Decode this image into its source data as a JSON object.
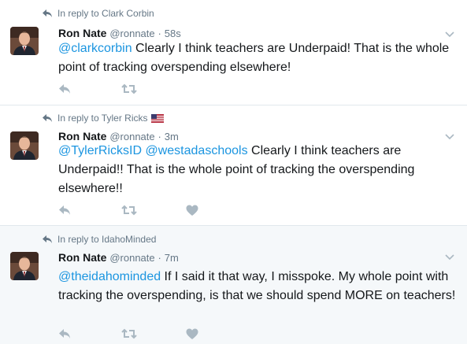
{
  "tweets": [
    {
      "reply_to": "In reply to Clark Corbin",
      "has_flag": false,
      "name": "Ron Nate",
      "handle": "@ronnate",
      "separator": "·",
      "time": "58s",
      "mentions": [
        "@clarkcorbin"
      ],
      "body": " Clearly I think teachers are Underpaid!  That is the whole point of tracking overspending elsewhere!"
    },
    {
      "reply_to": "In reply to Tyler Ricks",
      "has_flag": true,
      "flag_icon": "us-flag-icon",
      "name": "Ron Nate",
      "handle": "@ronnate",
      "separator": "·",
      "time": "3m",
      "mentions": [
        "@TylerRicksID",
        "@westadaschools"
      ],
      "body": " Clearly I think teachers are Underpaid!!  That is the whole point of tracking the overspending elsewhere!!"
    },
    {
      "reply_to": "In reply to IdahoMinded",
      "has_flag": false,
      "name": "Ron Nate",
      "handle": "@ronnate",
      "separator": "·",
      "time": "7m",
      "mentions": [
        "@theidahominded"
      ],
      "body": " If I said it that way, I misspoke.  My whole point with tracking the overspending, is that we should spend MORE on teachers!"
    }
  ],
  "icons": {
    "reply": "reply-arrow-icon",
    "retweet": "retweet-icon",
    "like": "heart-icon",
    "more": "chevron-down-icon"
  },
  "colors": {
    "link": "#1b95e0",
    "muted": "#657786",
    "highlight_bg": "#f5f8fa",
    "border": "#e1e8ed"
  }
}
